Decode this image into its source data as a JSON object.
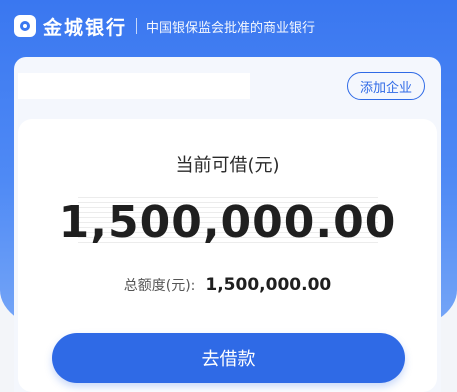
{
  "brand": {
    "name": "金城银行",
    "slogan": "中国银保监会批准的商业银行"
  },
  "company": {
    "add_label": "添加企业"
  },
  "loan": {
    "available_label": "当前可借(元)",
    "available_amount": "1,500,000.00",
    "total_label": "总额度(元):",
    "total_value": "1,500,000.00",
    "borrow_label": "去借款"
  },
  "colors": {
    "accent": "#2f6ae6",
    "header_gradient_top": "#3a77f0",
    "header_gradient_bottom": "#76a6f7"
  }
}
